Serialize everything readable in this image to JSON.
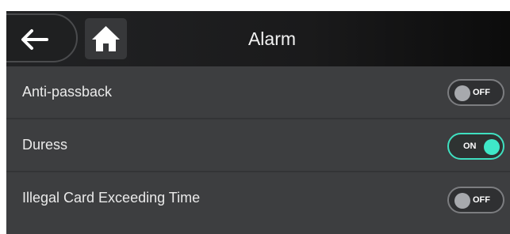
{
  "header": {
    "title": "Alarm",
    "back_icon": "arrow-left-icon",
    "home_icon": "home-icon"
  },
  "settings": [
    {
      "label": "Anti-passback",
      "state": "OFF",
      "enabled": false
    },
    {
      "label": "Duress",
      "state": "ON",
      "enabled": true
    },
    {
      "label": "Illegal Card Exceeding Time",
      "state": "OFF",
      "enabled": false
    }
  ],
  "colors": {
    "accent_on": "#3fe8c8",
    "background": "#3d3e40",
    "header": "#1a1a1b"
  }
}
